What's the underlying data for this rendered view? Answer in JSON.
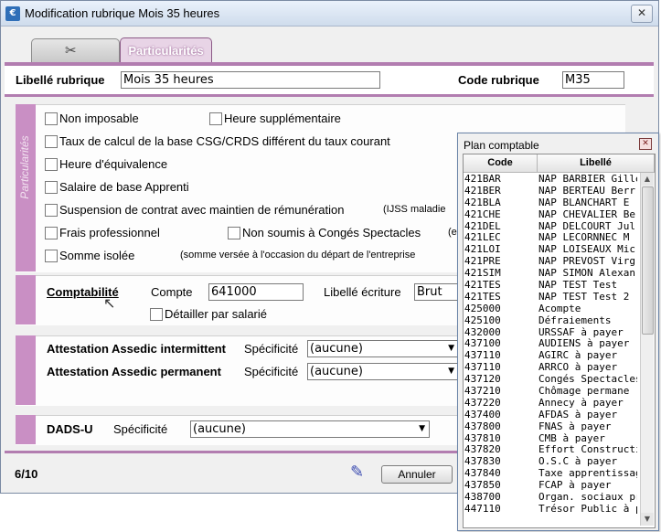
{
  "window": {
    "title": "Modification rubrique Mois 35 heures",
    "close_label": "✕"
  },
  "tabs": {
    "tab2_label": "Particularités"
  },
  "form": {
    "libelle_label": "Libellé rubrique",
    "libelle_value": "Mois 35 heures",
    "code_label": "Code rubrique",
    "code_value": "M35"
  },
  "particularites": {
    "strip_label": "Particularités",
    "non_imposable": "Non imposable",
    "heure_supp": "Heure supplémentaire",
    "taux_calcul": "Taux de calcul de la base CSG/CRDS différent du taux courant",
    "heure_equiv": "Heure d'équivalence",
    "salaire_base": "Salaire de base Apprenti",
    "suspension": "Suspension de contrat avec maintien de rémunération",
    "suspension_note": "(IJSS maladie",
    "frais_pro": "Frais professionnel",
    "non_soumis": "Non soumis à Congés Spectacles",
    "non_soumis_note": "(e",
    "somme_isolee": "Somme isolée",
    "somme_note": "(somme versée à l'occasion du départ de l'entreprise"
  },
  "comptabilite": {
    "title": "Comptabilité",
    "compte_label": "Compte",
    "compte_value": "641000",
    "libelle_ecriture_label": "Libellé écriture",
    "libelle_ecriture_value": "Brut",
    "detailler": "Détailler par salarié"
  },
  "assedic": {
    "intermittent_label": "Attestation Assedic intermittent",
    "permanent_label": "Attestation Assedic permanent",
    "specificite_label": "Spécificité",
    "intermittent_value": "(aucune)",
    "permanent_value": "(aucune)"
  },
  "dads": {
    "label": "DADS-U",
    "specificite_label": "Spécificité",
    "value": "(aucune)"
  },
  "status": {
    "page": "6/10",
    "annuler": "Annuler"
  },
  "popup": {
    "title": "Plan comptable",
    "close": "✕",
    "col_code": "Code",
    "col_libelle": "Libellé",
    "rows": [
      {
        "code": "421BAR",
        "libelle": "NAP BARBIER Gille"
      },
      {
        "code": "421BER",
        "libelle": "NAP BERTEAU Berr"
      },
      {
        "code": "421BLA",
        "libelle": "NAP BLANCHART E"
      },
      {
        "code": "421CHE",
        "libelle": "NAP CHEVALIER Be"
      },
      {
        "code": "421DEL",
        "libelle": "NAP DELCOURT Jul"
      },
      {
        "code": "421LEC",
        "libelle": "NAP LECORNNEC M"
      },
      {
        "code": "421LOI",
        "libelle": "NAP LOISEAUX Mic"
      },
      {
        "code": "421PRE",
        "libelle": "NAP PREVOST Virg"
      },
      {
        "code": "421SIM",
        "libelle": "NAP SIMON Alexan"
      },
      {
        "code": "421TES",
        "libelle": "NAP TEST Test"
      },
      {
        "code": "421TES",
        "libelle": "NAP TEST  Test 2"
      },
      {
        "code": "425000",
        "libelle": "Acompte"
      },
      {
        "code": "425100",
        "libelle": "Défraiements"
      },
      {
        "code": "432000",
        "libelle": "URSSAF à payer"
      },
      {
        "code": "437100",
        "libelle": "AUDIENS à payer"
      },
      {
        "code": "437110",
        "libelle": "AGIRC à payer"
      },
      {
        "code": "437110",
        "libelle": "ARRCO à payer"
      },
      {
        "code": "437120",
        "libelle": "Congés Spectacles"
      },
      {
        "code": "437210",
        "libelle": "Chômage permane"
      },
      {
        "code": "437220",
        "libelle": "Annecy à payer"
      },
      {
        "code": "437400",
        "libelle": "AFDAS à payer"
      },
      {
        "code": "437800",
        "libelle": "FNAS à payer"
      },
      {
        "code": "437810",
        "libelle": "CMB à payer"
      },
      {
        "code": "437820",
        "libelle": "Effort Construction"
      },
      {
        "code": "437830",
        "libelle": "O.S.C à payer"
      },
      {
        "code": "437840",
        "libelle": "Taxe apprentissage"
      },
      {
        "code": "437850",
        "libelle": "FCAP à payer"
      },
      {
        "code": "438700",
        "libelle": "Organ. sociaux pro"
      },
      {
        "code": "447110",
        "libelle": "Trésor Public à pay"
      }
    ]
  }
}
